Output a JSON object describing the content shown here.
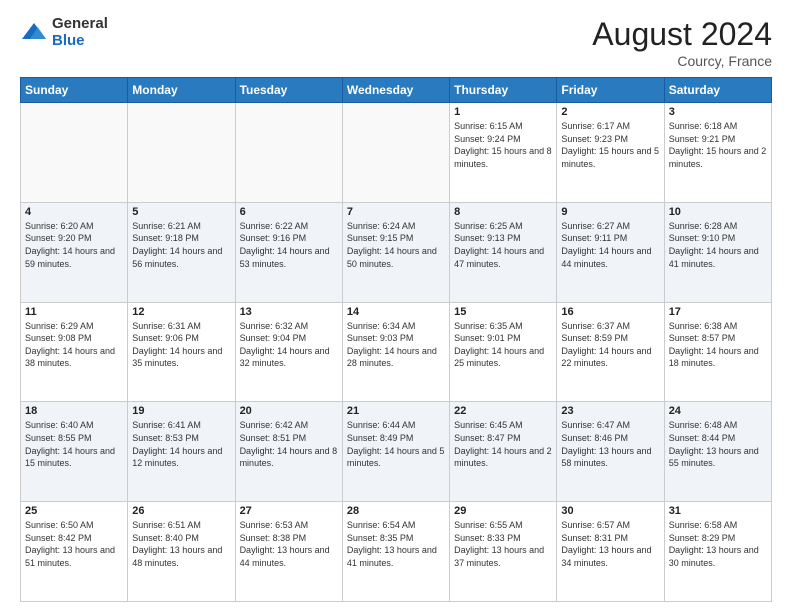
{
  "header": {
    "logo_general": "General",
    "logo_blue": "Blue",
    "title": "August 2024",
    "subtitle": "Courcy, France"
  },
  "days_of_week": [
    "Sunday",
    "Monday",
    "Tuesday",
    "Wednesday",
    "Thursday",
    "Friday",
    "Saturday"
  ],
  "weeks": [
    [
      {
        "day": "",
        "empty": true
      },
      {
        "day": "",
        "empty": true
      },
      {
        "day": "",
        "empty": true
      },
      {
        "day": "",
        "empty": true
      },
      {
        "day": "1",
        "sunrise": "6:15 AM",
        "sunset": "9:24 PM",
        "daylight": "15 hours and 8 minutes."
      },
      {
        "day": "2",
        "sunrise": "6:17 AM",
        "sunset": "9:23 PM",
        "daylight": "15 hours and 5 minutes."
      },
      {
        "day": "3",
        "sunrise": "6:18 AM",
        "sunset": "9:21 PM",
        "daylight": "15 hours and 2 minutes."
      }
    ],
    [
      {
        "day": "4",
        "sunrise": "6:20 AM",
        "sunset": "9:20 PM",
        "daylight": "14 hours and 59 minutes."
      },
      {
        "day": "5",
        "sunrise": "6:21 AM",
        "sunset": "9:18 PM",
        "daylight": "14 hours and 56 minutes."
      },
      {
        "day": "6",
        "sunrise": "6:22 AM",
        "sunset": "9:16 PM",
        "daylight": "14 hours and 53 minutes."
      },
      {
        "day": "7",
        "sunrise": "6:24 AM",
        "sunset": "9:15 PM",
        "daylight": "14 hours and 50 minutes."
      },
      {
        "day": "8",
        "sunrise": "6:25 AM",
        "sunset": "9:13 PM",
        "daylight": "14 hours and 47 minutes."
      },
      {
        "day": "9",
        "sunrise": "6:27 AM",
        "sunset": "9:11 PM",
        "daylight": "14 hours and 44 minutes."
      },
      {
        "day": "10",
        "sunrise": "6:28 AM",
        "sunset": "9:10 PM",
        "daylight": "14 hours and 41 minutes."
      }
    ],
    [
      {
        "day": "11",
        "sunrise": "6:29 AM",
        "sunset": "9:08 PM",
        "daylight": "14 hours and 38 minutes."
      },
      {
        "day": "12",
        "sunrise": "6:31 AM",
        "sunset": "9:06 PM",
        "daylight": "14 hours and 35 minutes."
      },
      {
        "day": "13",
        "sunrise": "6:32 AM",
        "sunset": "9:04 PM",
        "daylight": "14 hours and 32 minutes."
      },
      {
        "day": "14",
        "sunrise": "6:34 AM",
        "sunset": "9:03 PM",
        "daylight": "14 hours and 28 minutes."
      },
      {
        "day": "15",
        "sunrise": "6:35 AM",
        "sunset": "9:01 PM",
        "daylight": "14 hours and 25 minutes."
      },
      {
        "day": "16",
        "sunrise": "6:37 AM",
        "sunset": "8:59 PM",
        "daylight": "14 hours and 22 minutes."
      },
      {
        "day": "17",
        "sunrise": "6:38 AM",
        "sunset": "8:57 PM",
        "daylight": "14 hours and 18 minutes."
      }
    ],
    [
      {
        "day": "18",
        "sunrise": "6:40 AM",
        "sunset": "8:55 PM",
        "daylight": "14 hours and 15 minutes."
      },
      {
        "day": "19",
        "sunrise": "6:41 AM",
        "sunset": "8:53 PM",
        "daylight": "14 hours and 12 minutes."
      },
      {
        "day": "20",
        "sunrise": "6:42 AM",
        "sunset": "8:51 PM",
        "daylight": "14 hours and 8 minutes."
      },
      {
        "day": "21",
        "sunrise": "6:44 AM",
        "sunset": "8:49 PM",
        "daylight": "14 hours and 5 minutes."
      },
      {
        "day": "22",
        "sunrise": "6:45 AM",
        "sunset": "8:47 PM",
        "daylight": "14 hours and 2 minutes."
      },
      {
        "day": "23",
        "sunrise": "6:47 AM",
        "sunset": "8:46 PM",
        "daylight": "13 hours and 58 minutes."
      },
      {
        "day": "24",
        "sunrise": "6:48 AM",
        "sunset": "8:44 PM",
        "daylight": "13 hours and 55 minutes."
      }
    ],
    [
      {
        "day": "25",
        "sunrise": "6:50 AM",
        "sunset": "8:42 PM",
        "daylight": "13 hours and 51 minutes."
      },
      {
        "day": "26",
        "sunrise": "6:51 AM",
        "sunset": "8:40 PM",
        "daylight": "13 hours and 48 minutes."
      },
      {
        "day": "27",
        "sunrise": "6:53 AM",
        "sunset": "8:38 PM",
        "daylight": "13 hours and 44 minutes."
      },
      {
        "day": "28",
        "sunrise": "6:54 AM",
        "sunset": "8:35 PM",
        "daylight": "13 hours and 41 minutes."
      },
      {
        "day": "29",
        "sunrise": "6:55 AM",
        "sunset": "8:33 PM",
        "daylight": "13 hours and 37 minutes."
      },
      {
        "day": "30",
        "sunrise": "6:57 AM",
        "sunset": "8:31 PM",
        "daylight": "13 hours and 34 minutes."
      },
      {
        "day": "31",
        "sunrise": "6:58 AM",
        "sunset": "8:29 PM",
        "daylight": "13 hours and 30 minutes."
      }
    ]
  ]
}
